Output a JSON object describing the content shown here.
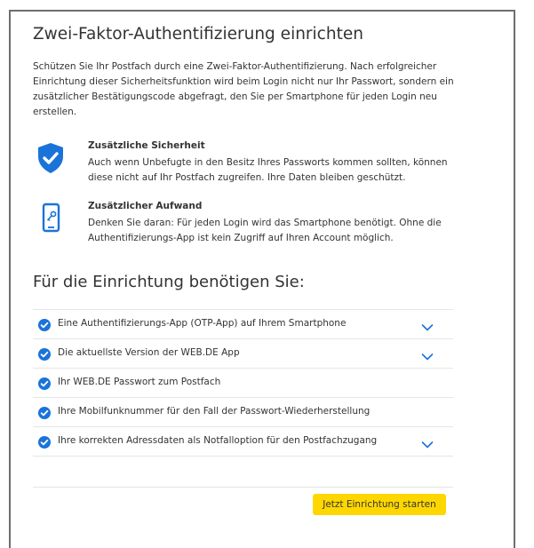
{
  "header": {
    "title": "Zwei-Faktor-Authentifizierung einrichten"
  },
  "intro": "Schützen Sie Ihr Postfach durch eine Zwei-Faktor-Authentifizierung. Nach erfolgreicher Einrichtung dieser Sicherheitsfunktion wird beim Login nicht nur Ihr Passwort, sondern ein zusätzlicher Bestätigungscode abgefragt, den Sie per Smartphone für jeden Login neu erstellen.",
  "features": [
    {
      "icon": "shield-check-icon",
      "title": "Zusätzliche Sicherheit",
      "description": "Auch wenn Unbefugte in den Besitz Ihres Passworts kommen sollten, können diese nicht auf Ihr Postfach zugreifen. Ihre Daten bleiben geschützt."
    },
    {
      "icon": "smartphone-key-icon",
      "title": "Zusätzlicher Aufwand",
      "description": "Denken Sie daran: Für jeden Login wird das Smartphone benötigt. Ohne die Authentifizierungs-App ist kein Zugriff auf Ihren Account möglich."
    }
  ],
  "requirements": {
    "title": "Für die Einrichtung benötigen Sie:",
    "items": [
      {
        "label": "Eine Authentifizierungs-App (OTP-App) auf Ihrem Smartphone",
        "expandable": true
      },
      {
        "label": "Die aktuellste Version der WEB.DE App",
        "expandable": true
      },
      {
        "label": "Ihr WEB.DE Passwort zum Postfach",
        "expandable": false
      },
      {
        "label": "Ihre Mobilfunknummer für den Fall der Passwort-Wiederherstellung",
        "expandable": false
      },
      {
        "label": "Ihre korrekten Adressdaten als Notfalloption für den Postfachzugang",
        "expandable": true
      }
    ]
  },
  "actions": {
    "start_label": "Jetzt Einrichtung starten"
  },
  "colors": {
    "accent_blue": "#1a73d9",
    "button_yellow": "#ffd700",
    "frame_gray": "#6e6e6e",
    "divider": "#e5e5e5"
  }
}
